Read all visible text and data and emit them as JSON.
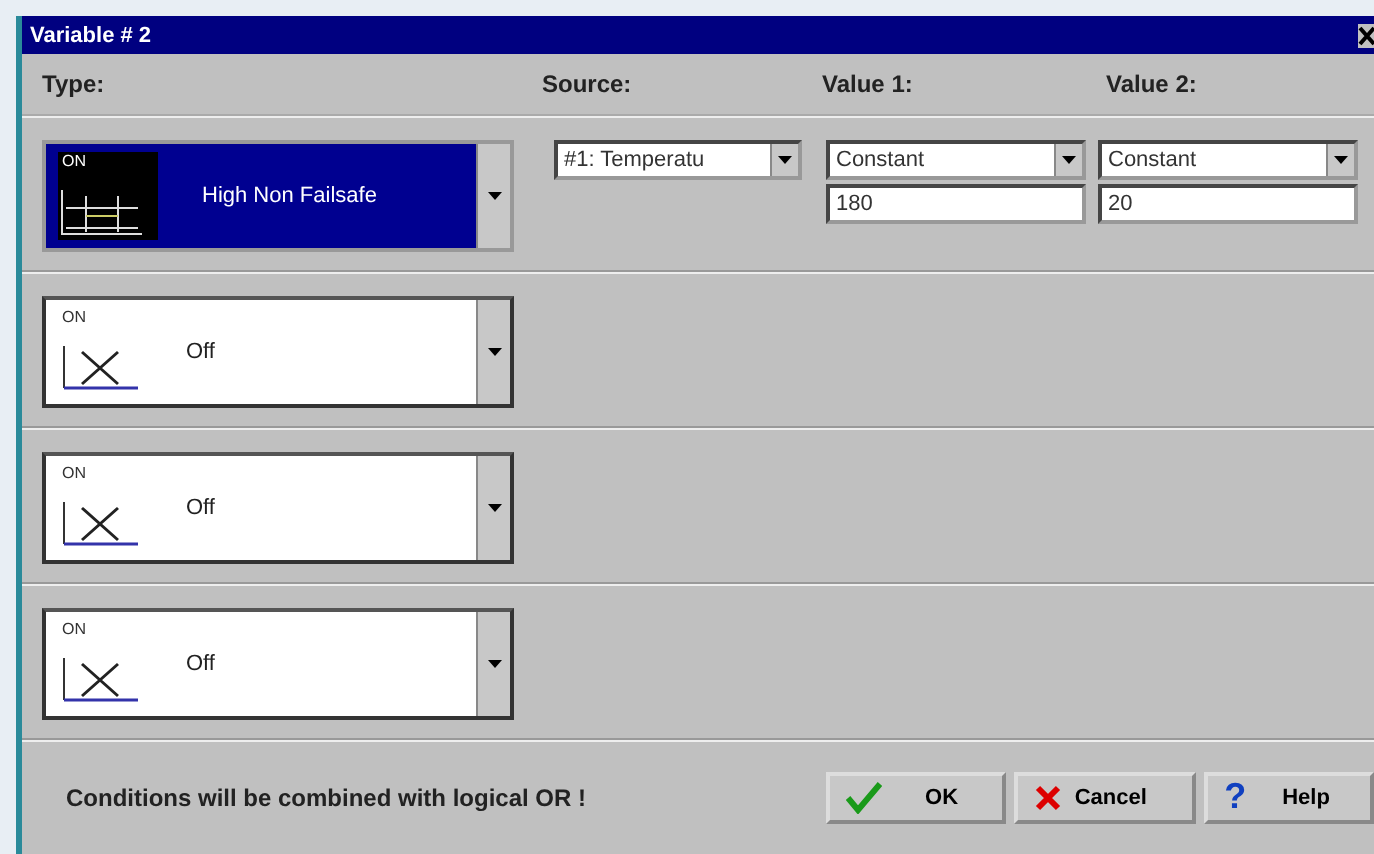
{
  "window": {
    "title": "Variable # 2"
  },
  "columns": [
    "Type:",
    "Source:",
    "Value 1:",
    "Value 2:"
  ],
  "conditions": [
    {
      "type_label": "High Non Failsafe",
      "kind": "high",
      "icon_label": "ON",
      "selected": true,
      "source": "#1: Temperatu",
      "value_1": {
        "mode": "Constant",
        "value": "180"
      },
      "value_2": {
        "mode": "Constant",
        "value": "20"
      }
    },
    {
      "type_label": "Off",
      "kind": "off",
      "icon_label": "ON",
      "selected": false
    },
    {
      "type_label": "Off",
      "kind": "off",
      "icon_label": "ON",
      "selected": false
    },
    {
      "type_label": "Off",
      "kind": "off",
      "icon_label": "ON",
      "selected": false
    }
  ],
  "note": "Conditions will be combined with logical OR !",
  "buttons": [
    {
      "kind": "ok",
      "label": "OK"
    },
    {
      "kind": "cancel",
      "label": "Cancel"
    },
    {
      "kind": "help",
      "label": "Help",
      "icon_text": "?"
    }
  ]
}
